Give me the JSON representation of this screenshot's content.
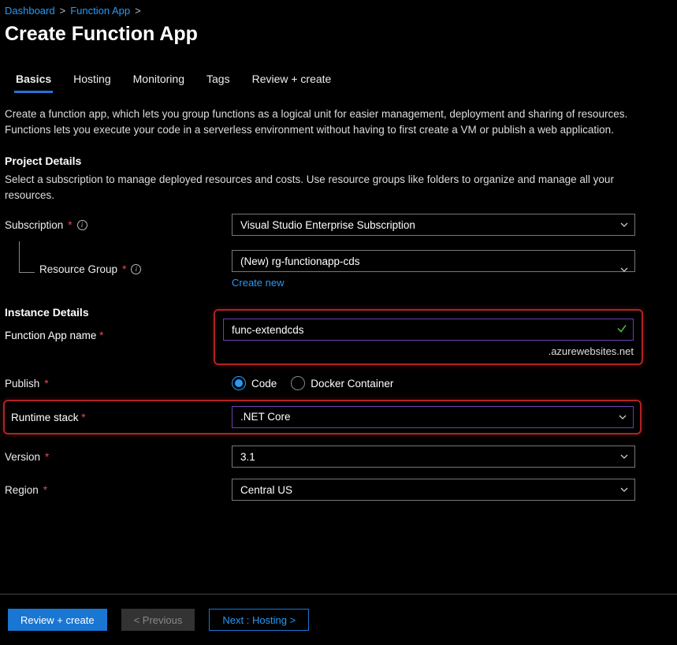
{
  "breadcrumb": {
    "items": [
      "Dashboard",
      "Function App"
    ],
    "sep": ">"
  },
  "title": "Create Function App",
  "tabs": [
    "Basics",
    "Hosting",
    "Monitoring",
    "Tags",
    "Review + create"
  ],
  "intro": "Create a function app, which lets you group functions as a logical unit for easier management, deployment and sharing of resources. Functions lets you execute your code in a serverless environment without having to first create a VM or publish a web application.",
  "project": {
    "header": "Project Details",
    "desc": "Select a subscription to manage deployed resources and costs. Use resource groups like folders to organize and manage all your resources.",
    "subscription_label": "Subscription",
    "subscription_value": "Visual Studio Enterprise Subscription",
    "rg_label": "Resource Group",
    "rg_value": "(New) rg-functionapp-cds",
    "create_new": "Create new"
  },
  "instance": {
    "header": "Instance Details",
    "appname_label": "Function App name",
    "appname_value": "func-extendcds",
    "domain_suffix": ".azurewebsites.net",
    "publish_label": "Publish",
    "publish_options": [
      "Code",
      "Docker Container"
    ],
    "runtime_label": "Runtime stack",
    "runtime_value": ".NET Core",
    "version_label": "Version",
    "version_value": "3.1",
    "region_label": "Region",
    "region_value": "Central US"
  },
  "footer": {
    "review": "Review + create",
    "previous": "< Previous",
    "next": "Next : Hosting >"
  },
  "glyphs": {
    "asterisk": "*"
  }
}
